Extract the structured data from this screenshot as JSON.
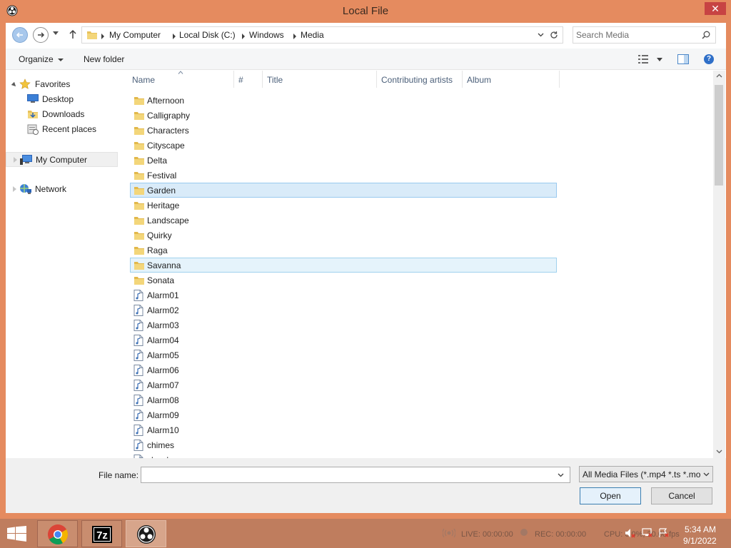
{
  "window": {
    "title": "Local File"
  },
  "address": {
    "crumbs": [
      "My Computer",
      "Local Disk (C:)",
      "Windows",
      "Media"
    ]
  },
  "search": {
    "placeholder": "Search Media"
  },
  "commandbar": {
    "organize": "Organize",
    "new_folder": "New folder"
  },
  "nav": {
    "favorites": "Favorites",
    "desktop": "Desktop",
    "downloads": "Downloads",
    "recent": "Recent places",
    "mycomputer": "My Computer",
    "network": "Network"
  },
  "columns": {
    "name": "Name",
    "number": "#",
    "title": "Title",
    "artists": "Contributing artists",
    "album": "Album"
  },
  "files": [
    {
      "name": "Afternoon",
      "type": "folder"
    },
    {
      "name": "Calligraphy",
      "type": "folder"
    },
    {
      "name": "Characters",
      "type": "folder"
    },
    {
      "name": "Cityscape",
      "type": "folder"
    },
    {
      "name": "Delta",
      "type": "folder"
    },
    {
      "name": "Festival",
      "type": "folder"
    },
    {
      "name": "Garden",
      "type": "folder",
      "selected": true
    },
    {
      "name": "Heritage",
      "type": "folder"
    },
    {
      "name": "Landscape",
      "type": "folder"
    },
    {
      "name": "Quirky",
      "type": "folder"
    },
    {
      "name": "Raga",
      "type": "folder"
    },
    {
      "name": "Savanna",
      "type": "folder",
      "selected": true
    },
    {
      "name": "Sonata",
      "type": "folder"
    },
    {
      "name": "Alarm01",
      "type": "audio"
    },
    {
      "name": "Alarm02",
      "type": "audio"
    },
    {
      "name": "Alarm03",
      "type": "audio"
    },
    {
      "name": "Alarm04",
      "type": "audio"
    },
    {
      "name": "Alarm05",
      "type": "audio"
    },
    {
      "name": "Alarm06",
      "type": "audio"
    },
    {
      "name": "Alarm07",
      "type": "audio"
    },
    {
      "name": "Alarm08",
      "type": "audio"
    },
    {
      "name": "Alarm09",
      "type": "audio"
    },
    {
      "name": "Alarm10",
      "type": "audio"
    },
    {
      "name": "chimes",
      "type": "audio"
    },
    {
      "name": "chord",
      "type": "audio"
    }
  ],
  "bottom": {
    "filename_label": "File name:",
    "filename_value": "",
    "filetype": "All Media Files (*.mp4 *.ts *.mo",
    "open": "Open",
    "cancel": "Cancel"
  },
  "taskbar": {
    "live": "LIVE: 00:00:00",
    "rec": "REC: 00:00:00",
    "cpu": "CPU: 0.0%, 30.00 fps",
    "time": "5:34 AM",
    "date": "9/1/2022"
  },
  "colors": {
    "window_frame": "#e58b5f",
    "taskbar": "#bf7d5e",
    "selection": "#d9ebf9",
    "selection_border": "#99c9ef"
  }
}
